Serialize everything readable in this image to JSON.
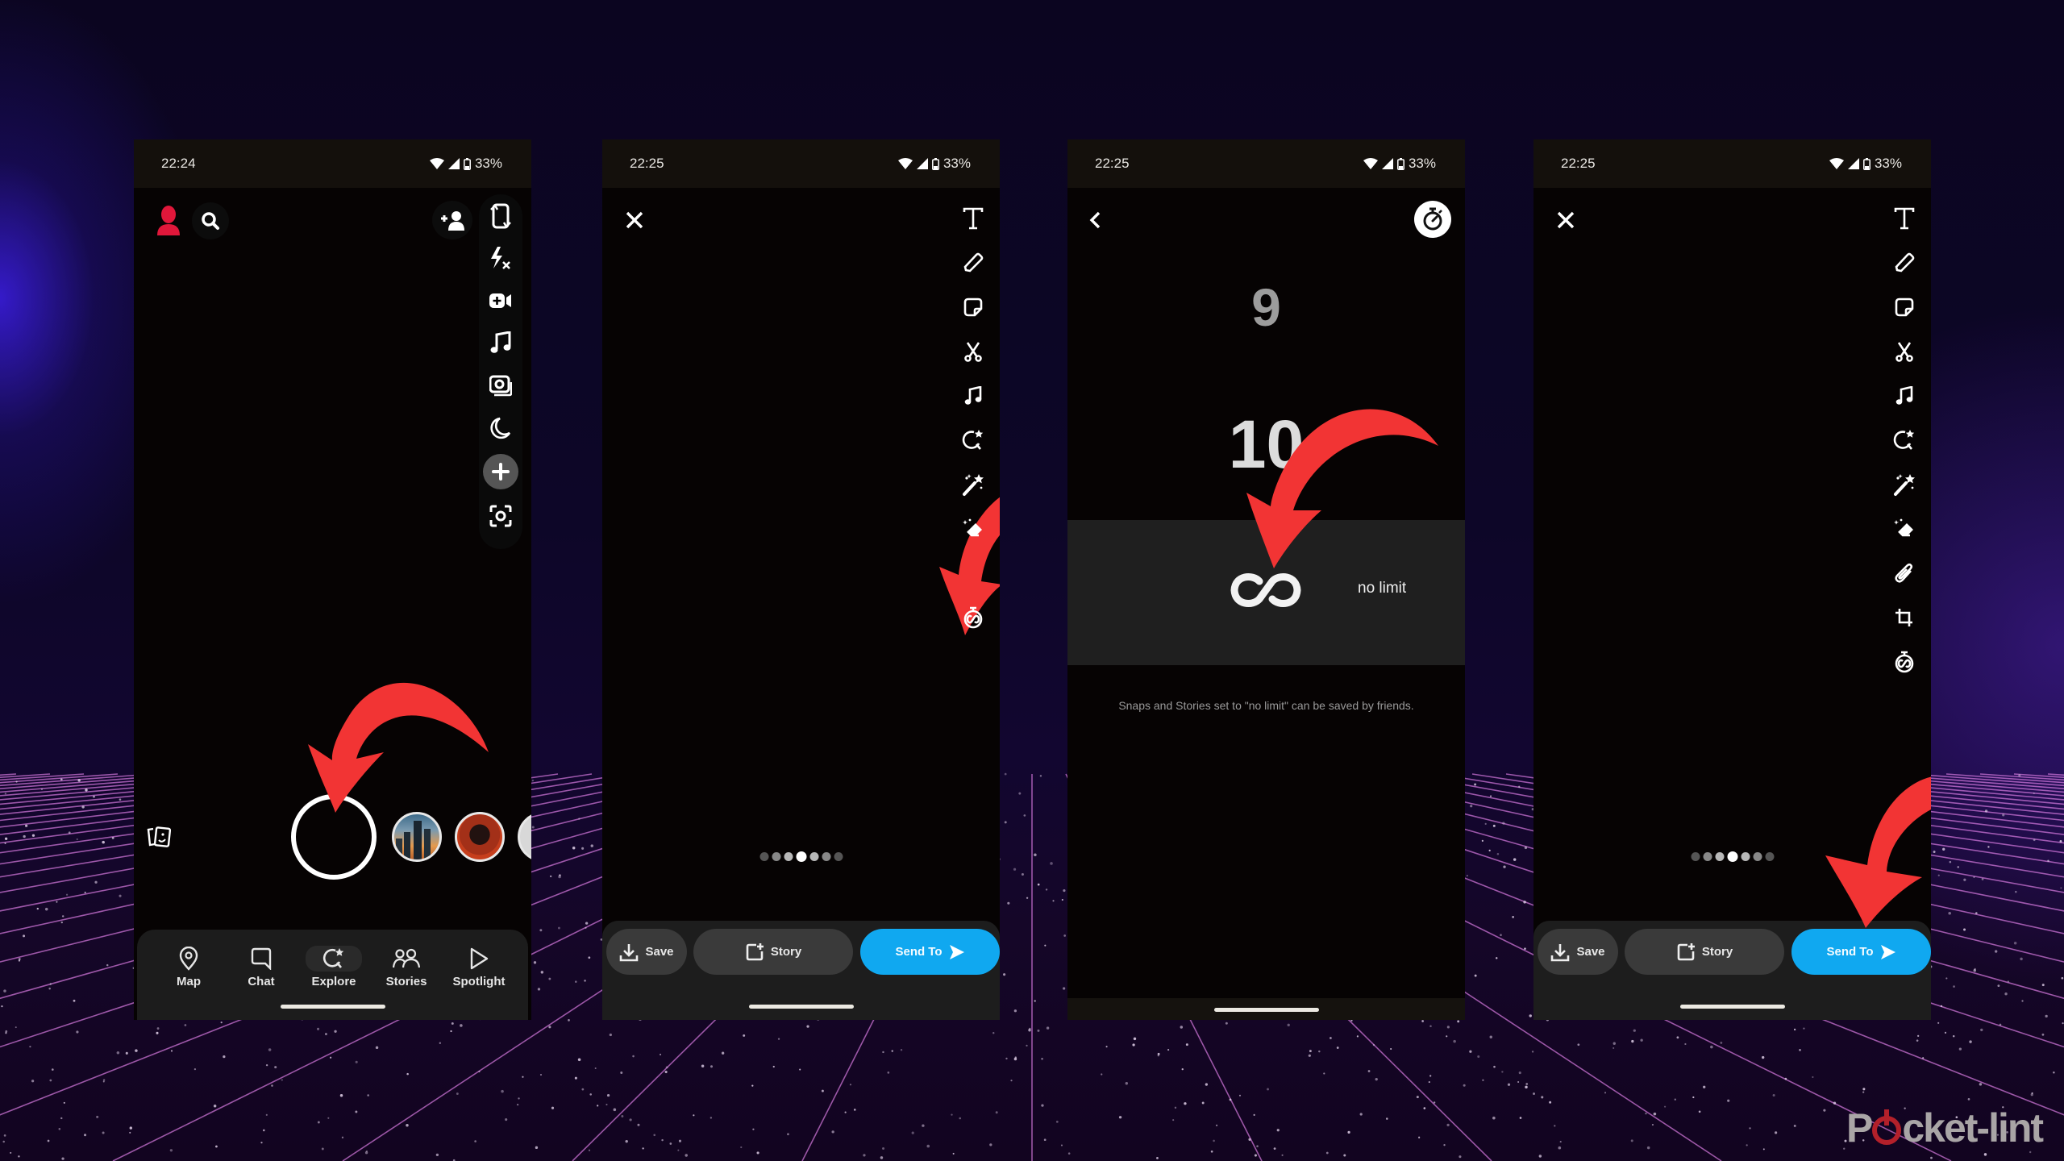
{
  "watermark": {
    "brand": "Pocketlint",
    "brand_prefix": "P",
    "brand_suffix": "cket-lint",
    "accent": "#b3202a"
  },
  "colors": {
    "arrow": "#f23434",
    "send_button": "#10a8f0",
    "profile_icon": "#e0173a"
  },
  "phones": [
    {
      "id": "camera",
      "status": {
        "time": "22:24",
        "battery": "33%",
        "wifi_icon": "wifi-icon",
        "signal_icon": "signal-icon",
        "battery_icon": "battery-icon"
      },
      "top_left": [
        {
          "name": "profile-avatar-icon"
        },
        {
          "name": "search-icon"
        }
      ],
      "top_right": [
        {
          "name": "add-friend-icon"
        }
      ],
      "right_rail": [
        "flip-camera-icon",
        "flash-off-icon",
        "video-chat-icon",
        "music-note-icon",
        "multi-snap-icon",
        "night-mode-icon",
        "plus-icon",
        "scan-icon"
      ],
      "memories_icon": "memories-icon",
      "stories_row": [
        "city-skyline-story",
        "hooded-figure-story",
        "partial-story"
      ],
      "nav": [
        {
          "label": "Map",
          "icon": "map-pin-icon"
        },
        {
          "label": "Chat",
          "icon": "chat-bubble-icon"
        },
        {
          "label": "Explore",
          "icon": "explore-icon",
          "active": true
        },
        {
          "label": "Stories",
          "icon": "stories-people-icon"
        },
        {
          "label": "Spotlight",
          "icon": "spotlight-play-icon"
        }
      ]
    },
    {
      "id": "editor",
      "status": {
        "time": "22:25",
        "battery": "33%"
      },
      "tools": [
        "text-tool-icon",
        "pencil-icon",
        "sticker-icon",
        "scissors-icon",
        "music-note-icon",
        "lens-explore-icon",
        "magic-wand-icon",
        "magic-eraser-icon",
        "timer-infinity-icon"
      ],
      "pager": {
        "count": 7,
        "active_index": 3
      },
      "actions": {
        "save": "Save",
        "story": "Story",
        "send": "Send To"
      }
    },
    {
      "id": "timer-picker",
      "status": {
        "time": "22:25",
        "battery": "33%"
      },
      "picker": {
        "above": "9",
        "middle": "10",
        "selected_label": "no limit"
      },
      "note": "Snaps and Stories set to \"no limit\" can be saved by friends."
    },
    {
      "id": "editor-after",
      "status": {
        "time": "22:25",
        "battery": "33%"
      },
      "tools": [
        "text-tool-icon",
        "pencil-icon",
        "sticker-icon",
        "scissors-icon",
        "music-note-icon",
        "lens-explore-icon",
        "magic-wand-icon",
        "magic-eraser-icon",
        "paperclip-icon",
        "crop-icon",
        "timer-infinity-icon"
      ],
      "pager": {
        "count": 7,
        "active_index": 3
      },
      "actions": {
        "save": "Save",
        "story": "Story",
        "send": "Send To"
      }
    }
  ]
}
